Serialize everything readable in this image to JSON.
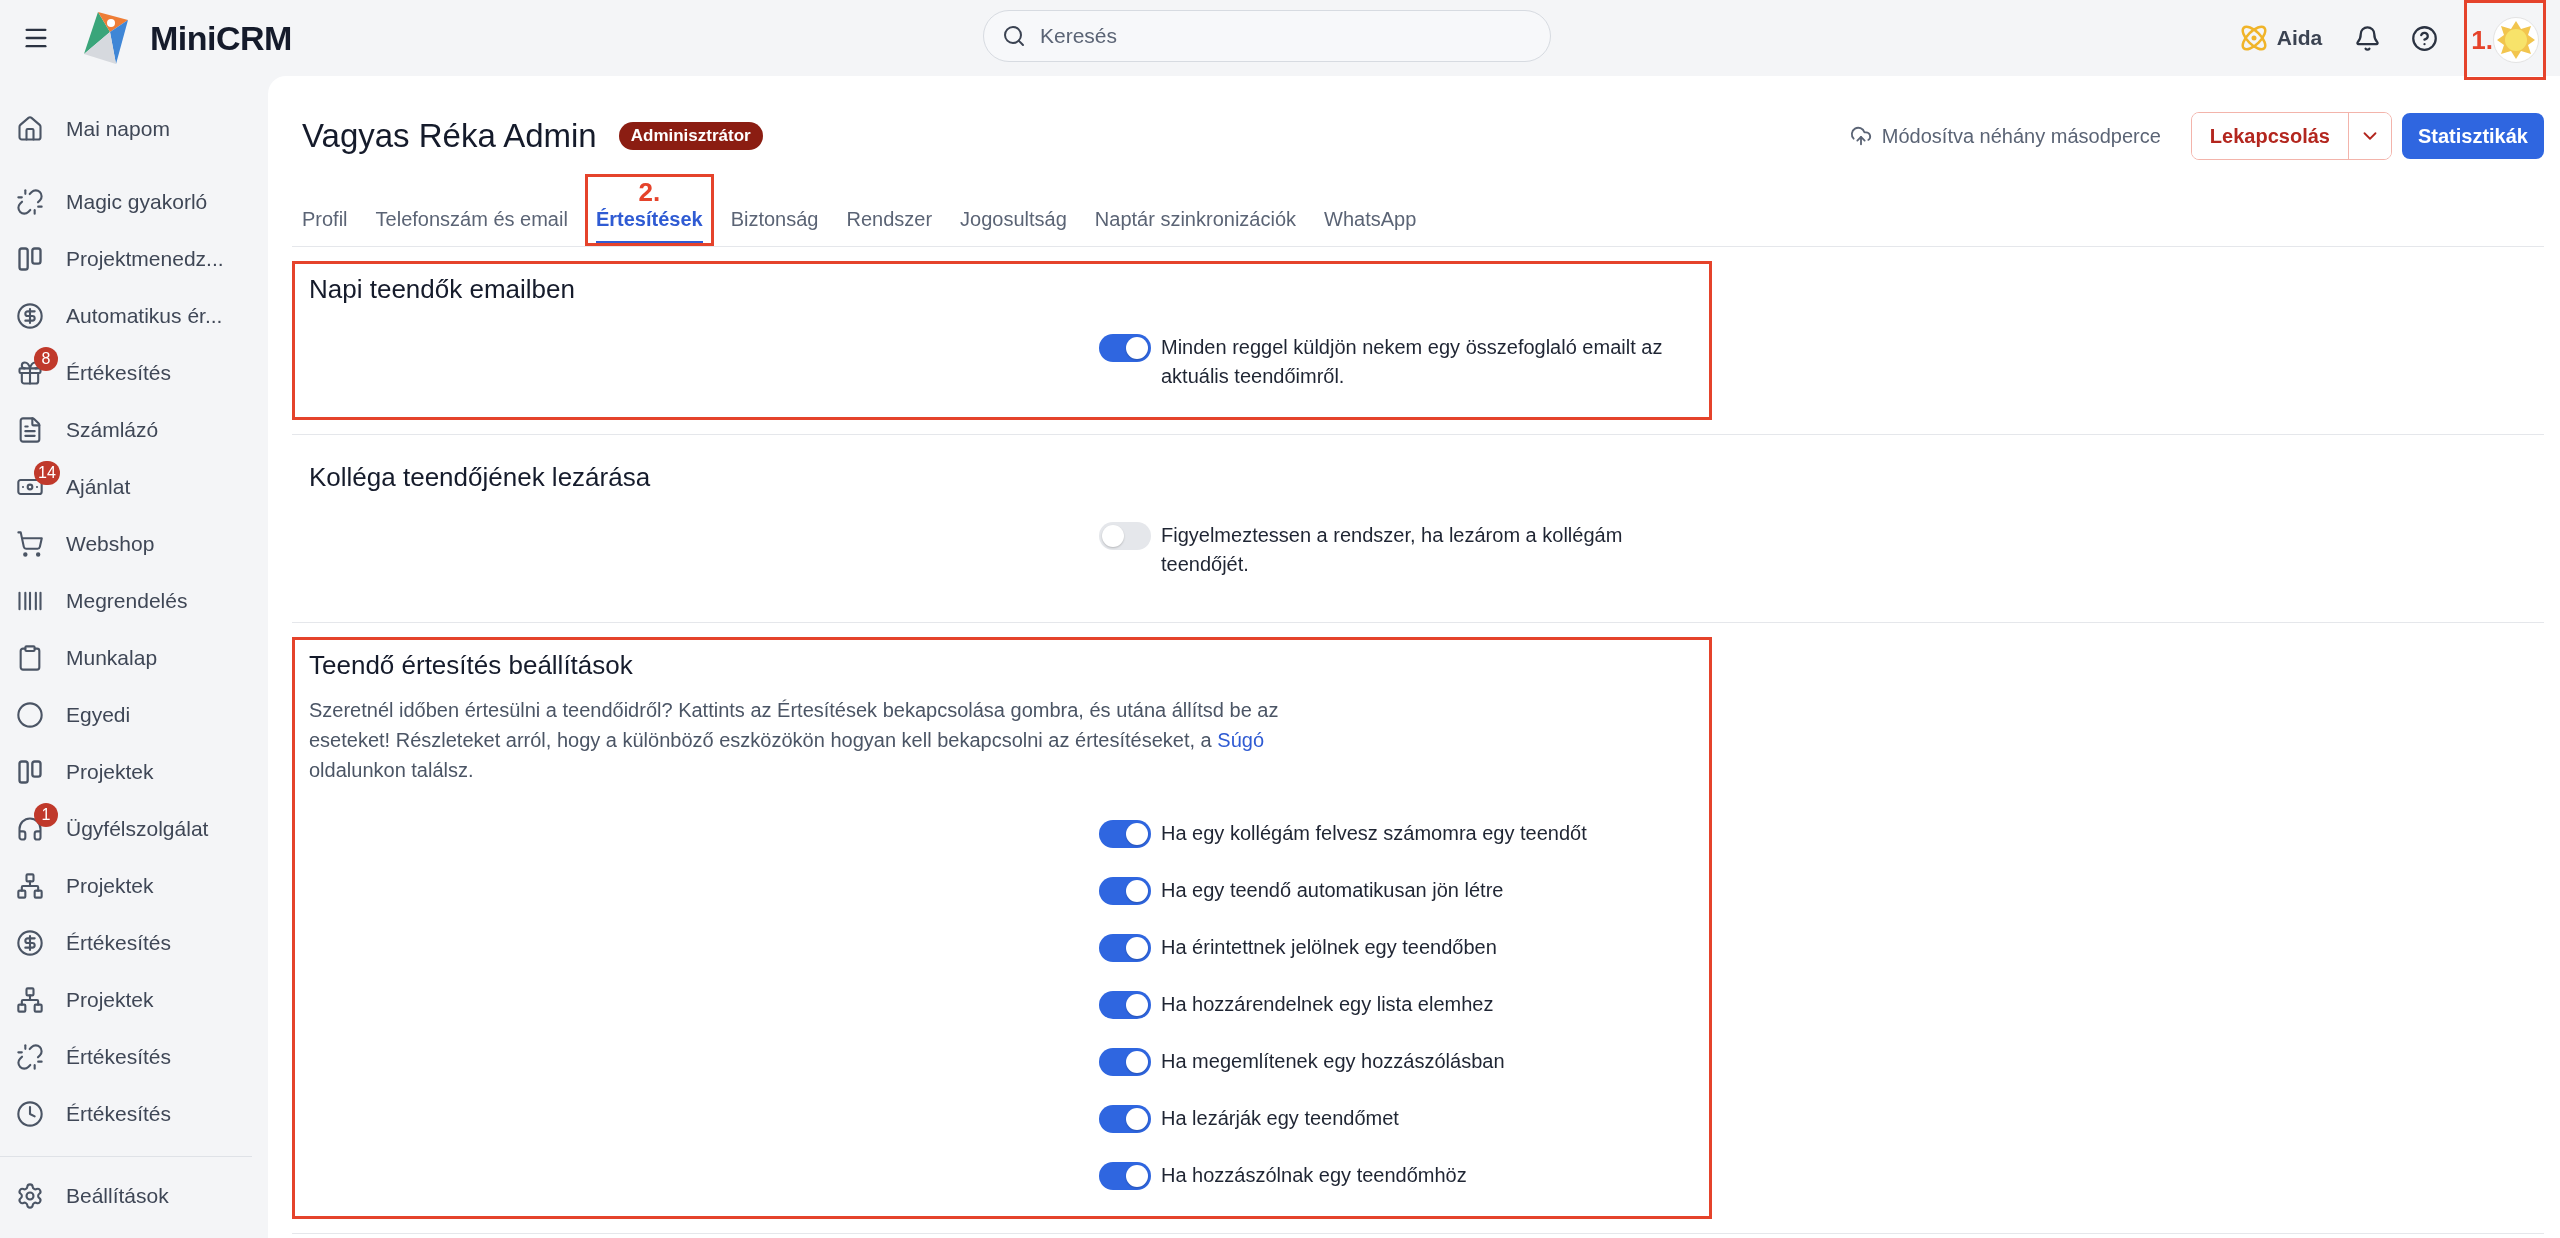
{
  "topbar": {
    "brand": "MiniCRM",
    "search": {
      "placeholder": "Keresés"
    },
    "assistant": "Aida",
    "avatar": {
      "annotation": "1."
    }
  },
  "sidebar": {
    "items": [
      {
        "label": "Mai napom",
        "kind": "home"
      },
      {
        "label": "Magic gyakorló",
        "kind": "link"
      },
      {
        "label": "Projektmenedz...",
        "kind": "columns"
      },
      {
        "label": "Automatikus ér...",
        "kind": "dollar"
      },
      {
        "label": "Értékesítés",
        "kind": "gift",
        "badge": "8"
      },
      {
        "label": "Számlázó",
        "kind": "file"
      },
      {
        "label": "Ajánlat",
        "kind": "money",
        "badge": "14"
      },
      {
        "label": "Webshop",
        "kind": "cart"
      },
      {
        "label": "Megrendelés",
        "kind": "barcode"
      },
      {
        "label": "Munkalap",
        "kind": "clipboard"
      },
      {
        "label": "Egyedi",
        "kind": "circle"
      },
      {
        "label": "Projektek",
        "kind": "columns"
      },
      {
        "label": "Ügyfélszolgálat",
        "kind": "headset",
        "badge": "1"
      },
      {
        "label": "Projektek",
        "kind": "network"
      },
      {
        "label": "Értékesítés",
        "kind": "dollar"
      },
      {
        "label": "Projektek",
        "kind": "network"
      },
      {
        "label": "Értékesítés",
        "kind": "link"
      },
      {
        "label": "Értékesítés",
        "kind": "clock"
      }
    ],
    "footer": {
      "label": "Beállítások",
      "kind": "settings"
    }
  },
  "header": {
    "title": "Vagyas Réka Admin",
    "role_badge": "Adminisztrátor",
    "save_status": "Módosítva néhány másodperce",
    "buttons": [
      {
        "label": "Lekapcsolás",
        "kind": "split"
      },
      {
        "label": "Statisztikák",
        "kind": "primary"
      }
    ]
  },
  "tabs": [
    {
      "label": "Profil",
      "selected": false
    },
    {
      "label": "Telefonszám és email",
      "selected": false
    },
    {
      "label": "Értesítések",
      "selected": true,
      "annotation": "2."
    },
    {
      "label": "Biztonság",
      "selected": false
    },
    {
      "label": "Rendszer",
      "selected": false
    },
    {
      "label": "Jogosultság",
      "selected": false
    },
    {
      "label": "Naptár szinkronizációk",
      "selected": false
    },
    {
      "label": "WhatsApp",
      "selected": false
    }
  ],
  "sections": [
    {
      "title": "Napi teendők emailben",
      "highlighted": true,
      "toggles": [
        {
          "label": "Minden reggel küldjön nekem egy összefoglaló emailt az aktuális teendőimről.",
          "on": true
        }
      ]
    },
    {
      "title": "Kolléga teendőjének lezárása",
      "highlighted": false,
      "toggles": [
        {
          "label": "Figyelmeztessen a rendszer, ha lezárom a kollégám teendőjét.",
          "on": false
        }
      ]
    },
    {
      "title": "Teendő értesítés beállítások",
      "highlighted": true,
      "description": "Szeretnél időben értesülni a teendőidről? Kattints az Értesítések bekapcsolása gombra, és utána állítsd be az eseteket! Részleteket arról, hogy a különböző eszközökön hogyan kell bekapcsolni az értesítéseket, a",
      "link": "Súgó",
      "description_end": "oldalunkon találsz.",
      "toggles": [
        {
          "label": "Ha egy kollégám felvesz számomra egy teendőt",
          "on": true
        },
        {
          "label": "Ha egy teendő automatikusan jön létre",
          "on": true
        },
        {
          "label": "Ha érintettnek jelölnek egy teendőben",
          "on": true
        },
        {
          "label": "Ha hozzárendelnek egy lista elemhez",
          "on": true
        },
        {
          "label": "Ha megemlítenek egy hozzászólásban",
          "on": true
        },
        {
          "label": "Ha lezárják egy teendőmet",
          "on": true
        },
        {
          "label": "Ha hozzászólnak egy teendőmhöz",
          "on": true
        }
      ]
    }
  ]
}
